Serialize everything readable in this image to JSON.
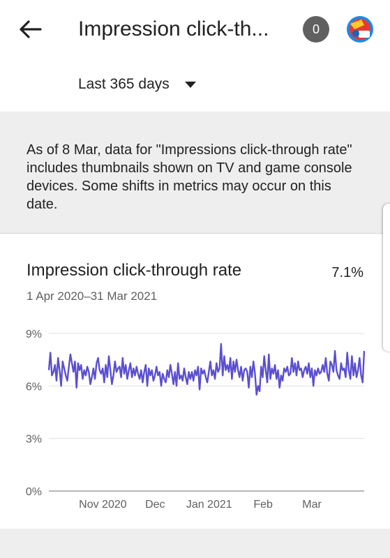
{
  "header": {
    "title": "Impression click-th...",
    "badge_count": "0"
  },
  "filter": {
    "period": "Last 365 days"
  },
  "notice": {
    "text": "As of 8 Mar, data for \"Impressions click-through rate\" includes thumbnails shown on TV and game console devices. Some shifts in metrics may occur on this date."
  },
  "card": {
    "title": "Impression click-through rate",
    "value": "7.1%",
    "date_range": "1 Apr 2020–31 Mar 2021"
  },
  "colors": {
    "line": "#5b4fd1",
    "grid": "#e0e0e0",
    "badge": "#606060"
  },
  "chart_data": {
    "type": "line",
    "title": "Impression click-through rate",
    "x_start": "2020-10-01",
    "x_end": "2021-03-31",
    "y_ticks": [
      "0%",
      "3%",
      "6%",
      "9%"
    ],
    "x_ticks": [
      {
        "label": "Nov 2020",
        "date": "2020-11-01"
      },
      {
        "label": "Dec",
        "date": "2020-12-01"
      },
      {
        "label": "Jan 2021",
        "date": "2021-01-01"
      },
      {
        "label": "Feb",
        "date": "2021-02-01"
      },
      {
        "label": "Mar",
        "date": "2021-03-01"
      }
    ],
    "ylim": [
      0,
      9
    ],
    "grid": true,
    "series": [
      {
        "values": [
          6.9,
          7.9,
          6.6,
          6.8,
          7.2,
          6.3,
          7.6,
          6.9,
          6.0,
          7.4,
          7.0,
          6.6,
          6.3,
          7.1,
          7.8,
          7.3,
          6.8,
          7.4,
          5.9,
          7.3,
          6.9,
          7.2,
          6.4,
          6.9,
          6.6,
          7.1,
          6.8,
          6.1,
          6.5,
          7.0,
          6.4,
          7.3,
          7.6,
          6.9,
          6.7,
          7.0,
          6.2,
          7.2,
          6.5,
          7.7,
          6.9,
          6.1,
          6.6,
          7.4,
          6.8,
          7.0,
          7.1,
          6.5,
          7.6,
          6.7,
          7.2,
          6.4,
          6.9,
          7.3,
          6.5,
          7.0,
          6.6,
          7.1,
          6.7,
          6.4,
          6.9,
          6.2,
          6.8,
          7.2,
          6.0,
          7.0,
          6.6,
          6.9,
          6.3,
          6.6,
          7.1,
          6.6,
          6.8,
          6.0,
          6.7,
          6.4,
          6.2,
          6.9,
          6.5,
          7.2,
          6.7,
          6.1,
          6.8,
          6.0,
          7.3,
          6.4,
          6.6,
          6.3,
          7.0,
          6.5,
          6.1,
          6.8,
          6.4,
          6.8,
          6.3,
          6.9,
          6.6,
          7.1,
          5.8,
          7.0,
          6.7,
          6.9,
          6.5,
          6.2,
          6.8,
          7.4,
          6.6,
          6.9,
          6.4,
          7.3,
          6.8,
          7.0,
          8.4,
          6.6,
          7.7,
          6.9,
          7.2,
          6.8,
          7.6,
          6.4,
          7.4,
          6.8,
          7.5,
          6.9,
          6.5,
          7.1,
          6.3,
          6.9,
          7.0,
          6.8,
          5.9,
          7.1,
          6.5,
          7.4,
          6.7,
          5.5,
          6.0,
          5.7,
          7.1,
          6.5,
          7.7,
          6.9,
          6.2,
          7.8,
          6.4,
          7.0,
          6.7,
          7.2,
          6.4,
          6.9,
          5.9,
          6.6,
          6.3,
          7.0,
          6.8,
          7.1,
          6.6,
          6.7,
          7.6,
          6.8,
          7.3,
          6.6,
          7.4,
          6.9,
          7.0,
          6.5,
          6.9,
          7.1,
          6.7,
          7.3,
          6.5,
          7.0,
          6.0,
          6.9,
          6.6,
          7.0,
          6.7,
          6.8,
          7.2,
          6.8,
          7.6,
          6.7,
          6.3,
          7.4,
          7.2,
          6.8,
          8.0,
          6.9,
          6.6,
          6.4,
          7.3,
          6.9,
          7.0,
          6.5,
          7.9,
          6.9,
          6.4,
          7.7,
          6.6,
          7.3,
          6.5,
          6.9,
          7.6,
          6.6,
          6.2,
          8.0
        ]
      }
    ]
  }
}
